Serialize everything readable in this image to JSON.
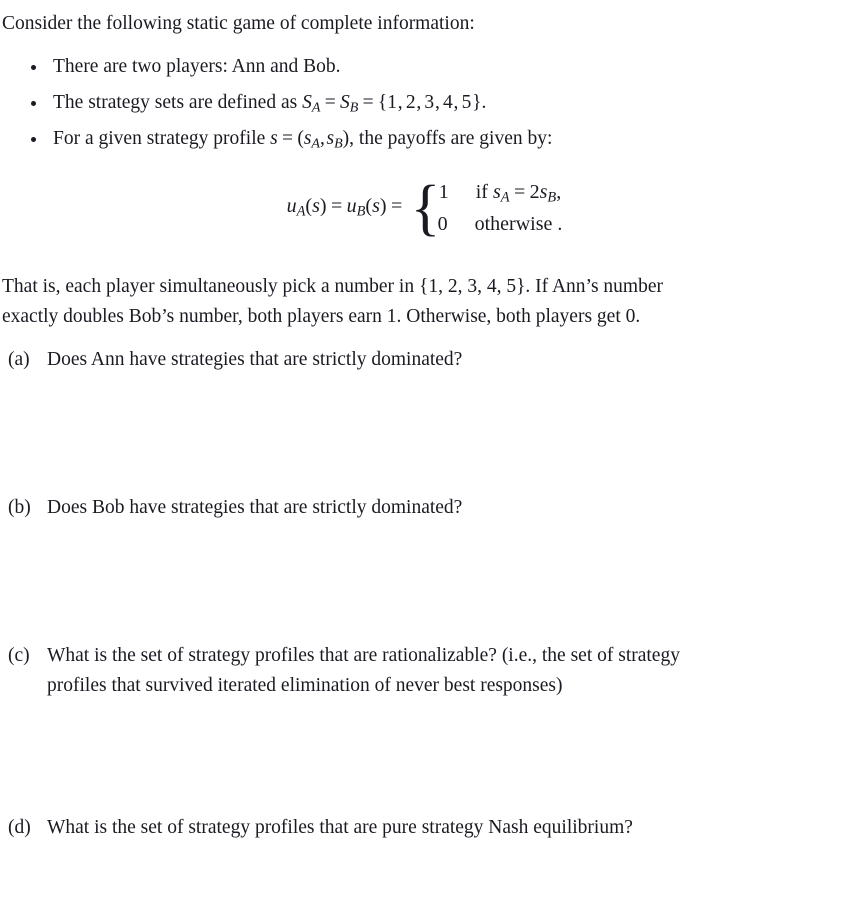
{
  "document": {
    "intro": "Consider the following static game of complete information:",
    "bullets": [
      {
        "id": "players",
        "text": "There are two players: Ann and Bob."
      },
      {
        "id": "strategy-sets",
        "prefix": "The strategy sets are defined as ",
        "math": "S_A = S_B = {1, 2, 3, 4, 5}.",
        "set_elements": [
          "1",
          "2",
          "3",
          "4",
          "5"
        ]
      },
      {
        "id": "payoff-intro",
        "prefix": "For a given strategy profile ",
        "math": "s = (s_A, s_B)",
        "suffix": ", the payoffs are given by:"
      }
    ],
    "equation": {
      "lhs": "u_A(s) = u_B(s) =",
      "cases": [
        {
          "value": "1",
          "condition": "if s_A = 2s_B,"
        },
        {
          "value": "0",
          "condition": "otherwise ."
        }
      ]
    },
    "paragraph": {
      "line1": "That is, each player simultaneously pick a number in {1, 2, 3, 4, 5}.  If Ann’s number",
      "line2": "exactly doubles Bob’s number, both players earn 1. Otherwise, both players get 0."
    },
    "questions": [
      {
        "label": "(a)",
        "line1": "Does Ann have strategies that are strictly dominated?",
        "line2": ""
      },
      {
        "label": "(b)",
        "line1": "Does Bob have strategies that are strictly dominated?",
        "line2": ""
      },
      {
        "label": "(c)",
        "line1": "What is the set of strategy profiles that are rationalizable? (i.e., the set of strategy",
        "line2": "profiles that survived iterated elimination of never best responses)"
      },
      {
        "label": "(d)",
        "line1": "What is the set of strategy profiles that are pure strategy Nash equilibrium?",
        "line2": ""
      }
    ],
    "symbols": {
      "brace": "{",
      "bullet": "•"
    },
    "colors": {
      "text": "#1a1a22",
      "background": "#ffffff"
    }
  }
}
